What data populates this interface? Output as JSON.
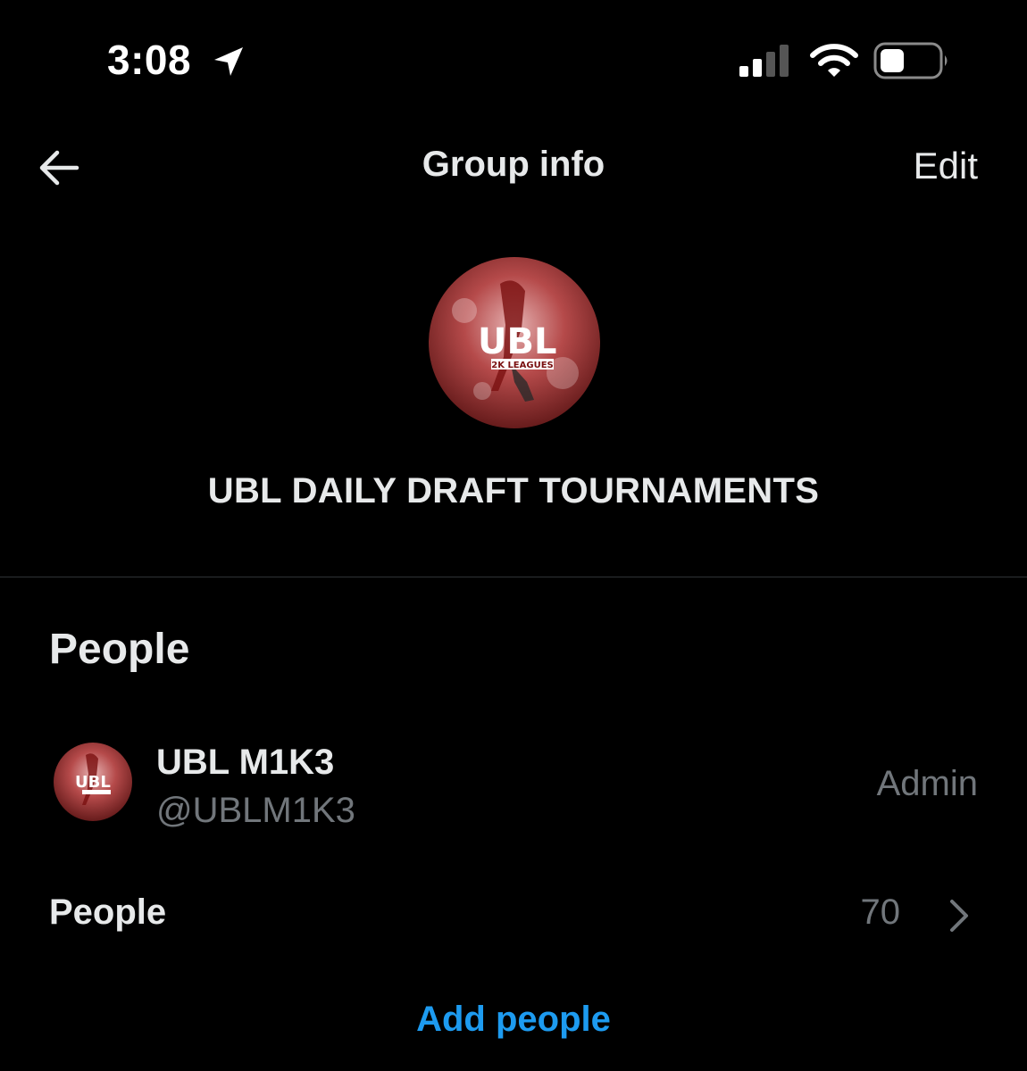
{
  "status_bar": {
    "time": "3:08",
    "location_icon": "location-arrow-icon",
    "signal_icon": "cellular-signal-icon",
    "wifi_icon": "wifi-icon",
    "battery_icon": "battery-icon"
  },
  "header": {
    "back_icon": "arrow-left-icon",
    "title": "Group info",
    "edit_label": "Edit"
  },
  "group": {
    "name": "UBL DAILY DRAFT TOURNAMENTS",
    "avatar_logo_text": "UBL",
    "avatar_sub_text": "2K LEAGUES"
  },
  "people_section": {
    "title": "People",
    "members": [
      {
        "name": "UBL M1K3",
        "handle": "@UBLM1K3",
        "role": "Admin"
      }
    ],
    "people_row_label": "People",
    "people_count": "70",
    "chevron_icon": "chevron-right-icon",
    "add_people_label": "Add people"
  },
  "colors": {
    "background": "#000000",
    "text_primary": "#e7e9ea",
    "text_secondary": "#71767b",
    "accent": "#1d9bf0",
    "divider": "#2f3336"
  }
}
